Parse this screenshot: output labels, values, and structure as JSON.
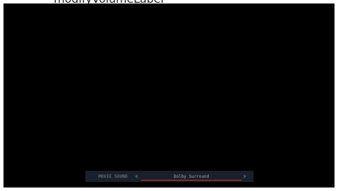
{
  "top_text": "modifyVolumeLabel",
  "osd": {
    "label": "MOVIE SOUND",
    "value": "Dolby Surround",
    "accent_color": "#c0392b",
    "left_arrow_icon": "chevron-left-icon",
    "right_arrow_icon": "chevron-right-icon"
  }
}
